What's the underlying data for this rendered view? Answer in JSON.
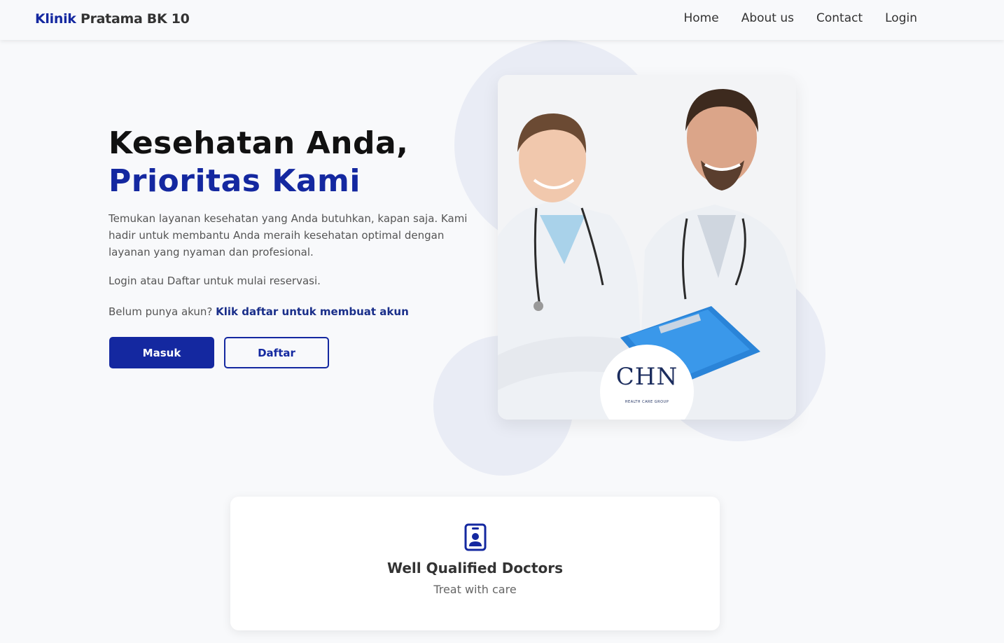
{
  "brand": {
    "part1": "Klinik",
    "part2": "Pratama BK 10"
  },
  "nav": {
    "home": "Home",
    "about": "About us",
    "contact": "Contact",
    "login": "Login"
  },
  "hero": {
    "title_line1": "Kesehatan Anda,",
    "title_line2": "Prioritas Kami",
    "description": "Temukan layanan kesehatan yang Anda butuhkan, kapan saja. Kami hadir untuk membantu Anda meraih kesehatan optimal dengan layanan yang nyaman dan profesional.",
    "login_prompt": "Login atau Daftar untuk mulai reservasi.",
    "signup_prompt": "Belum punya akun?",
    "signup_link": "Klik daftar untuk membuat akun",
    "btn_masuk": "Masuk",
    "btn_daftar": "Daftar"
  },
  "photo_logo": {
    "name": "CHN",
    "tagline": "HEALTH CARE GROUP"
  },
  "feature_card": {
    "icon": "id-badge-icon",
    "title": "Well Qualified Doctors",
    "subtitle": "Treat with care"
  },
  "colors": {
    "primary": "#1428a0",
    "background": "#f8f9fb",
    "circle": "#e9ecf5"
  }
}
